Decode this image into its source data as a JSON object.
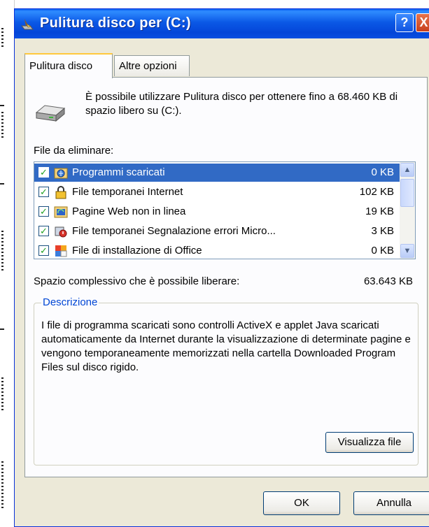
{
  "window": {
    "title": "Pulitura disco per  (C:)",
    "help_label": "?",
    "close_label": "X"
  },
  "tabs": [
    {
      "label": "Pulitura disco",
      "active": true
    },
    {
      "label": "Altre opzioni",
      "active": false
    }
  ],
  "intro_text": "È possibile utilizzare Pulitura disco per ottenere fino a 68.460 KB di spazio libero su  (C:).",
  "files_label": "File da eliminare:",
  "files": [
    {
      "name": "Programmi scaricati",
      "size": "0 KB",
      "checked": true,
      "selected": true,
      "icon": "downloaded-programs-icon"
    },
    {
      "name": "File temporanei Internet",
      "size": "102 KB",
      "checked": true,
      "selected": false,
      "icon": "lock-icon"
    },
    {
      "name": "Pagine Web non in linea",
      "size": "19 KB",
      "checked": true,
      "selected": false,
      "icon": "offline-web-pages-icon"
    },
    {
      "name": "File temporanei Segnalazione errori Micro...",
      "size": "3 KB",
      "checked": true,
      "selected": false,
      "icon": "error-reporting-icon"
    },
    {
      "name": "File di installazione di Office",
      "size": "0 KB",
      "checked": true,
      "selected": false,
      "icon": "office-setup-icon"
    }
  ],
  "total_label": "Spazio complessivo che è possibile liberare:",
  "total_value": "63.643 KB",
  "description": {
    "title": "Descrizione",
    "text": "I file di programma scaricati sono controlli ActiveX e applet Java scaricati automaticamente da Internet durante la visualizzazione di determinate pagine e vengono temporaneamente memorizzati nella cartella Downloaded Program Files sul disco rigido.",
    "view_button": "Visualizza file"
  },
  "buttons": {
    "ok": "OK",
    "cancel": "Annulla"
  },
  "colors": {
    "titlebar": "#0b58e6",
    "selection": "#316ac5",
    "group_title": "#0046d5",
    "dialog_bg": "#ece9d8"
  }
}
